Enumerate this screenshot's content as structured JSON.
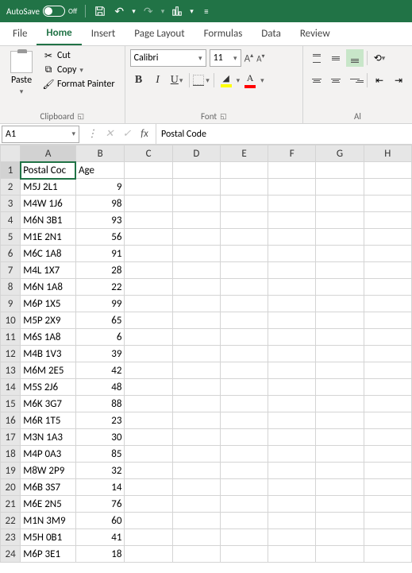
{
  "titlebar": {
    "autosave_label": "AutoSave",
    "autosave_state": "Off"
  },
  "tabs": {
    "file": "File",
    "home": "Home",
    "insert": "Insert",
    "page_layout": "Page Layout",
    "formulas": "Formulas",
    "data": "Data",
    "review": "Review"
  },
  "ribbon": {
    "clipboard": {
      "paste": "Paste",
      "cut": "Cut",
      "copy": "Copy",
      "format_painter": "Format Painter",
      "label": "Clipboard"
    },
    "font": {
      "name": "Calibri",
      "size": "11",
      "label": "Font"
    },
    "alignment": {
      "label": "Al"
    }
  },
  "namebox": "A1",
  "formula_bar": "Postal Code",
  "columns": [
    "A",
    "B",
    "C",
    "D",
    "E",
    "F",
    "G",
    "H"
  ],
  "headers": {
    "A": "Postal Code",
    "B": "Age"
  },
  "header_display": {
    "A": "Postal Coc",
    "B": "Age"
  },
  "rows": [
    {
      "n": 1,
      "A": "__HEADER__",
      "B": "__HEADER__"
    },
    {
      "n": 2,
      "A": "M5J 2L1",
      "B": 9
    },
    {
      "n": 3,
      "A": "M4W 1J6",
      "B": 98
    },
    {
      "n": 4,
      "A": "M6N 3B1",
      "B": 93
    },
    {
      "n": 5,
      "A": "M1E 2N1",
      "B": 56
    },
    {
      "n": 6,
      "A": "M6C 1A8",
      "B": 91
    },
    {
      "n": 7,
      "A": "M4L 1X7",
      "B": 28
    },
    {
      "n": 8,
      "A": "M6N 1A8",
      "B": 22
    },
    {
      "n": 9,
      "A": "M6P 1X5",
      "B": 99
    },
    {
      "n": 10,
      "A": "M5P 2X9",
      "B": 65
    },
    {
      "n": 11,
      "A": "M6S 1A8",
      "B": 6
    },
    {
      "n": 12,
      "A": "M4B 1V3",
      "B": 39
    },
    {
      "n": 13,
      "A": "M6M 2E5",
      "B": 42
    },
    {
      "n": 14,
      "A": "M5S 2J6",
      "B": 48
    },
    {
      "n": 15,
      "A": "M6K 3G7",
      "B": 88
    },
    {
      "n": 16,
      "A": "M6R 1T5",
      "B": 23
    },
    {
      "n": 17,
      "A": "M3N 1A3",
      "B": 30
    },
    {
      "n": 18,
      "A": "M4P 0A3",
      "B": 85
    },
    {
      "n": 19,
      "A": "M8W 2P9",
      "B": 32
    },
    {
      "n": 20,
      "A": "M6B 3S7",
      "B": 14
    },
    {
      "n": 21,
      "A": "M6E 2N5",
      "B": 76
    },
    {
      "n": 22,
      "A": "M1N 3M9",
      "B": 60
    },
    {
      "n": 23,
      "A": "M5H 0B1",
      "B": 41
    },
    {
      "n": 24,
      "A": "M6P 3E1",
      "B": 18
    }
  ]
}
